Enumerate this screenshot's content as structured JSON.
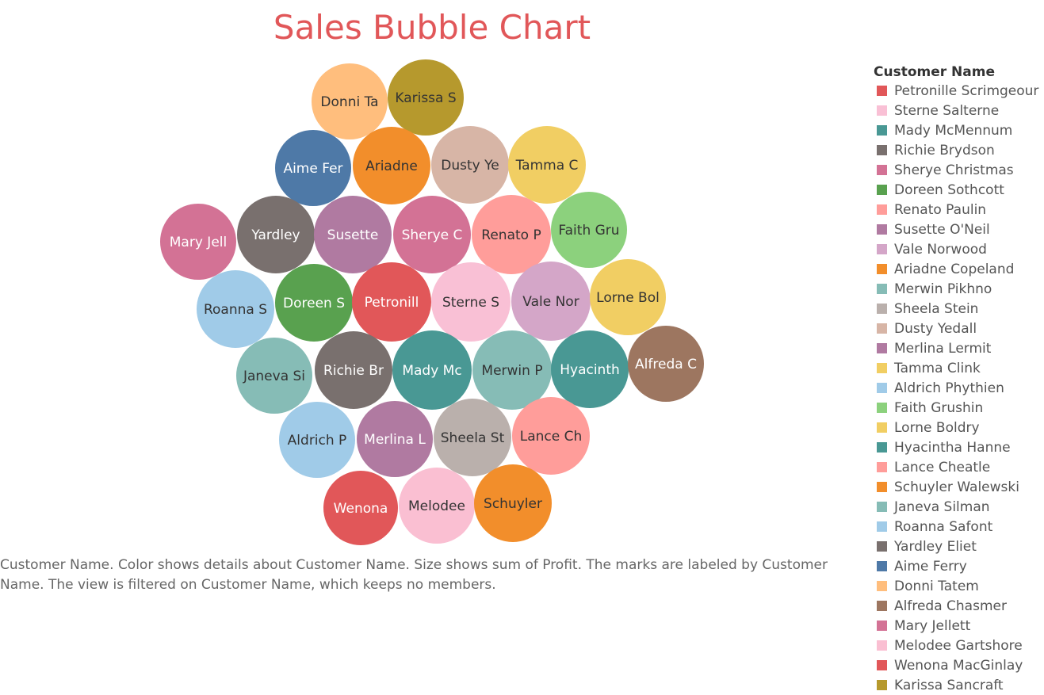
{
  "title": "Sales Bubble Chart",
  "caption": "Customer Name.  Color shows details about Customer Name.  Size shows sum of Profit.  The marks are labeled by Customer Name. The view is filtered on Customer Name, which keeps no members.",
  "legend": {
    "title": "Customer Name",
    "items": [
      {
        "name": "Petronille Scrimgeour",
        "color": "#e15759"
      },
      {
        "name": "Sterne Salterne",
        "color": "#f9c0d5"
      },
      {
        "name": "Mady McMennum",
        "color": "#499894"
      },
      {
        "name": "Richie Brydson",
        "color": "#79706e"
      },
      {
        "name": "Sherye Christmas",
        "color": "#d37295"
      },
      {
        "name": "Doreen Sothcott",
        "color": "#59a14f"
      },
      {
        "name": "Renato Paulin",
        "color": "#ff9d9a"
      },
      {
        "name": "Susette O'Neil",
        "color": "#b07aa1"
      },
      {
        "name": "Vale Norwood",
        "color": "#d4a6c8"
      },
      {
        "name": "Ariadne Copeland",
        "color": "#f28e2b"
      },
      {
        "name": "Merwin Pikhno",
        "color": "#86bcb6"
      },
      {
        "name": "Sheela Stein",
        "color": "#bab0ac"
      },
      {
        "name": "Dusty Yedall",
        "color": "#d7b5a6"
      },
      {
        "name": "Merlina Lermit",
        "color": "#b07aa1"
      },
      {
        "name": "Tamma Clink",
        "color": "#f1ce63"
      },
      {
        "name": "Aldrich Phythien",
        "color": "#a0cbe8"
      },
      {
        "name": "Faith Grushin",
        "color": "#8cd17d"
      },
      {
        "name": "Lorne Boldry",
        "color": "#f1ce63"
      },
      {
        "name": "Hyacintha Hanne",
        "color": "#499894"
      },
      {
        "name": "Lance Cheatle",
        "color": "#ff9d9a"
      },
      {
        "name": "Schuyler Walewski",
        "color": "#f28e2b"
      },
      {
        "name": "Janeva Silman",
        "color": "#86bcb6"
      },
      {
        "name": "Roanna Safont",
        "color": "#a0cbe8"
      },
      {
        "name": "Yardley Eliet",
        "color": "#79706e"
      },
      {
        "name": "Aime Ferry",
        "color": "#4e79a7"
      },
      {
        "name": "Donni Tatem",
        "color": "#ffbe7d"
      },
      {
        "name": "Alfreda Chasmer",
        "color": "#9d7660"
      },
      {
        "name": "Mary Jellett",
        "color": "#d37295"
      },
      {
        "name": "Melodee Gartshore",
        "color": "#fabfd2"
      },
      {
        "name": "Wenona MacGinlay",
        "color": "#e15759"
      },
      {
        "name": "Karissa Sancraft",
        "color": "#b6992d"
      }
    ]
  },
  "chart_data": {
    "type": "bubble",
    "title": "Sales Bubble Chart",
    "size_measure": "Sum of Profit",
    "color_dimension": "Customer Name",
    "label_dimension": "Customer Name",
    "bubbles": [
      {
        "label": "Donni Ta",
        "customer": "Donni Tatem",
        "color": "#ffbe7d",
        "text_color": "#333333"
      },
      {
        "label": "Karissa S",
        "customer": "Karissa Sancraft",
        "color": "#b6992d",
        "text_color": "#333333"
      },
      {
        "label": "Aime Fer",
        "customer": "Aime Ferry",
        "color": "#4e79a7",
        "text_color": "#ffffff"
      },
      {
        "label": "Ariadne",
        "customer": "Ariadne Copeland",
        "color": "#f28e2b",
        "text_color": "#333333"
      },
      {
        "label": "Dusty Ye",
        "customer": "Dusty Yedall",
        "color": "#d7b5a6",
        "text_color": "#333333"
      },
      {
        "label": "Tamma C",
        "customer": "Tamma Clink",
        "color": "#f1ce63",
        "text_color": "#333333"
      },
      {
        "label": "Mary Jell",
        "customer": "Mary Jellett",
        "color": "#d37295",
        "text_color": "#ffffff"
      },
      {
        "label": "Yardley",
        "customer": "Yardley Eliet",
        "color": "#79706e",
        "text_color": "#ffffff"
      },
      {
        "label": "Susette",
        "customer": "Susette O'Neil",
        "color": "#b07aa1",
        "text_color": "#ffffff"
      },
      {
        "label": "Sherye C",
        "customer": "Sherye Christmas",
        "color": "#d37295",
        "text_color": "#ffffff"
      },
      {
        "label": "Renato P",
        "customer": "Renato Paulin",
        "color": "#ff9d9a",
        "text_color": "#333333"
      },
      {
        "label": "Faith Gru",
        "customer": "Faith Grushin",
        "color": "#8cd17d",
        "text_color": "#333333"
      },
      {
        "label": "Roanna S",
        "customer": "Roanna Safont",
        "color": "#a0cbe8",
        "text_color": "#333333"
      },
      {
        "label": "Doreen S",
        "customer": "Doreen Sothcott",
        "color": "#59a14f",
        "text_color": "#ffffff"
      },
      {
        "label": "Petronill",
        "customer": "Petronille Scrimgeour",
        "color": "#e15759",
        "text_color": "#ffffff"
      },
      {
        "label": "Sterne S",
        "customer": "Sterne Salterne",
        "color": "#f9c0d5",
        "text_color": "#333333"
      },
      {
        "label": "Vale Nor",
        "customer": "Vale Norwood",
        "color": "#d4a6c8",
        "text_color": "#333333"
      },
      {
        "label": "Lorne Bol",
        "customer": "Lorne Boldry",
        "color": "#f1ce63",
        "text_color": "#333333"
      },
      {
        "label": "Janeva Si",
        "customer": "Janeva Silman",
        "color": "#86bcb6",
        "text_color": "#333333"
      },
      {
        "label": "Richie Br",
        "customer": "Richie Brydson",
        "color": "#79706e",
        "text_color": "#ffffff"
      },
      {
        "label": "Mady Mc",
        "customer": "Mady McMennum",
        "color": "#499894",
        "text_color": "#ffffff"
      },
      {
        "label": "Merwin P",
        "customer": "Merwin Pikhno",
        "color": "#86bcb6",
        "text_color": "#333333"
      },
      {
        "label": "Hyacinth",
        "customer": "Hyacintha Hanne",
        "color": "#499894",
        "text_color": "#ffffff"
      },
      {
        "label": "Alfreda C",
        "customer": "Alfreda Chasmer",
        "color": "#9d7660",
        "text_color": "#ffffff"
      },
      {
        "label": "Aldrich P",
        "customer": "Aldrich Phythien",
        "color": "#a0cbe8",
        "text_color": "#333333"
      },
      {
        "label": "Merlina L",
        "customer": "Merlina Lermit",
        "color": "#b07aa1",
        "text_color": "#ffffff"
      },
      {
        "label": "Sheela St",
        "customer": "Sheela Stein",
        "color": "#bab0ac",
        "text_color": "#333333"
      },
      {
        "label": "Lance Ch",
        "customer": "Lance Cheatle",
        "color": "#ff9d9a",
        "text_color": "#333333"
      },
      {
        "label": "Wenona",
        "customer": "Wenona MacGinlay",
        "color": "#e15759",
        "text_color": "#ffffff"
      },
      {
        "label": "Melodee",
        "customer": "Melodee Gartshore",
        "color": "#fabfd2",
        "text_color": "#333333"
      },
      {
        "label": "Schuyler",
        "customer": "Schuyler Walewski",
        "color": "#f28e2b",
        "text_color": "#333333"
      }
    ]
  }
}
